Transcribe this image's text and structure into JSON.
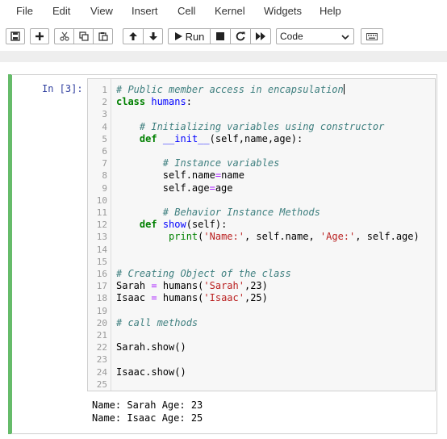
{
  "menu": [
    "File",
    "Edit",
    "View",
    "Insert",
    "Cell",
    "Kernel",
    "Widgets",
    "Help"
  ],
  "toolbar": {
    "run_label": "Run",
    "cell_type": "Code",
    "icons": [
      "save-icon",
      "plus-icon",
      "cut-icon",
      "copy-icon",
      "paste-icon",
      "arrow-up-icon",
      "arrow-down-icon",
      "play-icon",
      "stop-icon",
      "restart-icon",
      "fast-forward-icon",
      "keyboard-icon"
    ]
  },
  "cell": {
    "prompt": "In [3]:",
    "lines": [
      {
        "n": "1",
        "tokens": [
          {
            "t": "# Public member access in encapsulation",
            "c": "comment"
          }
        ],
        "cursor": true
      },
      {
        "n": "2",
        "tokens": [
          {
            "t": "class",
            "c": "keyword"
          },
          {
            "t": " "
          },
          {
            "t": "humans",
            "c": "def"
          },
          {
            "t": ":"
          }
        ]
      },
      {
        "n": "3",
        "tokens": []
      },
      {
        "n": "4",
        "tokens": [
          {
            "t": "    "
          },
          {
            "t": "# Initializing variables using constructor",
            "c": "comment"
          }
        ]
      },
      {
        "n": "5",
        "tokens": [
          {
            "t": "    "
          },
          {
            "t": "def",
            "c": "keyword"
          },
          {
            "t": " "
          },
          {
            "t": "__init__",
            "c": "def"
          },
          {
            "t": "(self,name,age):"
          }
        ]
      },
      {
        "n": "6",
        "tokens": []
      },
      {
        "n": "7",
        "tokens": [
          {
            "t": "        "
          },
          {
            "t": "# Instance variables",
            "c": "comment"
          }
        ]
      },
      {
        "n": "8",
        "tokens": [
          {
            "t": "        self.name"
          },
          {
            "t": "=",
            "c": "op"
          },
          {
            "t": "name"
          }
        ]
      },
      {
        "n": "9",
        "tokens": [
          {
            "t": "        self.age"
          },
          {
            "t": "=",
            "c": "op"
          },
          {
            "t": "age"
          }
        ]
      },
      {
        "n": "10",
        "tokens": []
      },
      {
        "n": "11",
        "tokens": [
          {
            "t": "        "
          },
          {
            "t": "# Behavior Instance Methods",
            "c": "comment"
          }
        ]
      },
      {
        "n": "12",
        "tokens": [
          {
            "t": "    "
          },
          {
            "t": "def",
            "c": "keyword"
          },
          {
            "t": " "
          },
          {
            "t": "show",
            "c": "def"
          },
          {
            "t": "(self):"
          }
        ]
      },
      {
        "n": "13",
        "tokens": [
          {
            "t": "         "
          },
          {
            "t": "print",
            "c": "builtin"
          },
          {
            "t": "("
          },
          {
            "t": "'Name:'",
            "c": "string"
          },
          {
            "t": ", self.name, "
          },
          {
            "t": "'Age:'",
            "c": "string"
          },
          {
            "t": ", self.age)"
          }
        ]
      },
      {
        "n": "14",
        "tokens": []
      },
      {
        "n": "15",
        "tokens": []
      },
      {
        "n": "16",
        "tokens": [
          {
            "t": "# Creating Object of the class",
            "c": "comment"
          }
        ]
      },
      {
        "n": "17",
        "tokens": [
          {
            "t": "Sarah "
          },
          {
            "t": "=",
            "c": "op"
          },
          {
            "t": " humans("
          },
          {
            "t": "'Sarah'",
            "c": "string"
          },
          {
            "t": ",23)"
          }
        ]
      },
      {
        "n": "18",
        "tokens": [
          {
            "t": "Isaac "
          },
          {
            "t": "=",
            "c": "op"
          },
          {
            "t": " humans("
          },
          {
            "t": "'Isaac'",
            "c": "string"
          },
          {
            "t": ",25)"
          }
        ]
      },
      {
        "n": "19",
        "tokens": []
      },
      {
        "n": "20",
        "tokens": [
          {
            "t": "# call methods",
            "c": "comment"
          }
        ]
      },
      {
        "n": "21",
        "tokens": []
      },
      {
        "n": "22",
        "tokens": [
          {
            "t": "Sarah.show()"
          }
        ]
      },
      {
        "n": "23",
        "tokens": []
      },
      {
        "n": "24",
        "tokens": [
          {
            "t": "Isaac.show()"
          }
        ]
      },
      {
        "n": "25",
        "tokens": []
      }
    ],
    "output": [
      "Name: Sarah Age: 23",
      "Name: Isaac Age: 25"
    ]
  },
  "colors": {
    "cell_selected_bar": "#66bb6a",
    "prompt": "#303f9f",
    "comment": "#408080",
    "keyword": "#008000",
    "string": "#ba2121"
  }
}
